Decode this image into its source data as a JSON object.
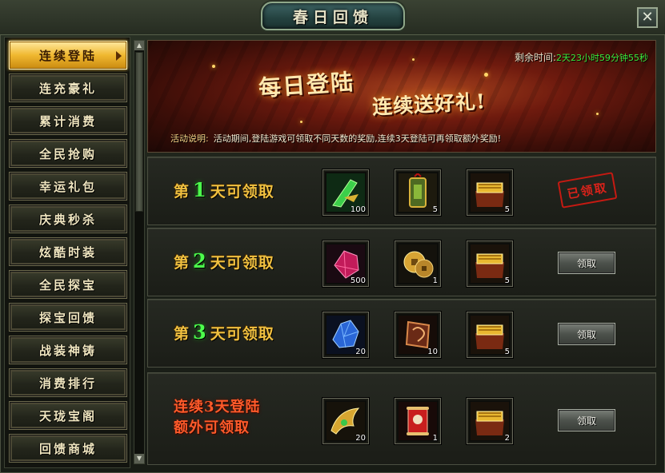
{
  "window": {
    "title": "春日回馈",
    "close_icon": "close-icon"
  },
  "sidebar": {
    "items": [
      {
        "label": "连续登陆",
        "active": true
      },
      {
        "label": "连充豪礼"
      },
      {
        "label": "累计消费"
      },
      {
        "label": "全民抢购"
      },
      {
        "label": "幸运礼包"
      },
      {
        "label": "庆典秒杀"
      },
      {
        "label": "炫酷时装"
      },
      {
        "label": "全民探宝"
      },
      {
        "label": "探宝回馈"
      },
      {
        "label": "战装神铸"
      },
      {
        "label": "消费排行"
      },
      {
        "label": "天珑宝阁"
      },
      {
        "label": "回馈商城"
      }
    ]
  },
  "banner": {
    "headline1": "每日登陆",
    "headline2": "连续送好礼!",
    "timer_label": "剩余时间:",
    "timer_value": "2天23小时59分钟55秒",
    "desc_label": "活动说明:",
    "desc_text": "活动期间,登陆游戏可领取不同天数的奖励,连续3天登陆可再领取额外奖励!"
  },
  "rows": [
    {
      "prefix": "第",
      "day": "1",
      "suffix": "天可领取",
      "claimed": true,
      "claimed_label": "已领取",
      "items": [
        {
          "icon": "green-blade-icon",
          "count": "100"
        },
        {
          "icon": "jade-token-icon",
          "count": "5"
        },
        {
          "icon": "gold-chest-icon",
          "count": "5"
        }
      ]
    },
    {
      "prefix": "第",
      "day": "2",
      "suffix": "天可领取",
      "claimed": false,
      "button_label": "领取",
      "items": [
        {
          "icon": "red-crystal-icon",
          "count": "500"
        },
        {
          "icon": "coin-icon",
          "count": "1"
        },
        {
          "icon": "gold-chest-icon",
          "count": "5"
        }
      ]
    },
    {
      "prefix": "第",
      "day": "3",
      "suffix": "天可领取",
      "claimed": false,
      "button_label": "领取",
      "items": [
        {
          "icon": "blue-crystal-icon",
          "count": "20"
        },
        {
          "icon": "rune-stone-icon",
          "count": "10"
        },
        {
          "icon": "gold-chest-icon",
          "count": "5"
        }
      ]
    },
    {
      "bonus_line1": "连续3天登陆",
      "bonus_line2": "额外可领取",
      "claimed": false,
      "button_label": "领取",
      "items": [
        {
          "icon": "gold-wing-icon",
          "count": "20"
        },
        {
          "icon": "red-scroll-icon",
          "count": "1"
        },
        {
          "icon": "gold-chest-icon",
          "count": "2"
        }
      ]
    }
  ]
}
